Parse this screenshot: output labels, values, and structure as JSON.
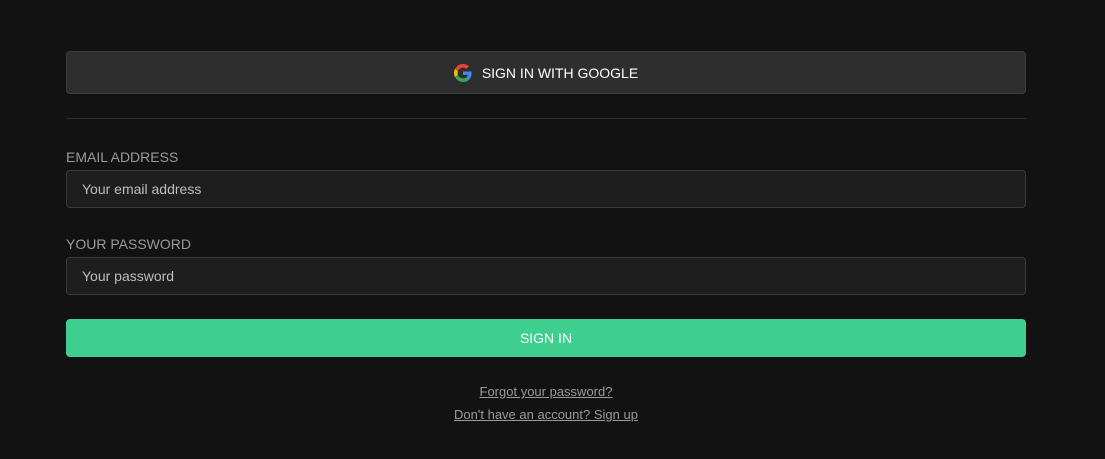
{
  "google_button": {
    "label": "SIGN IN WITH GOOGLE",
    "icon": "google-g-icon"
  },
  "email": {
    "label": "EMAIL ADDRESS",
    "placeholder": "Your email address",
    "value": ""
  },
  "password": {
    "label": "YOUR PASSWORD",
    "placeholder": "Your password",
    "value": ""
  },
  "signin_button": {
    "label": "SIGN IN"
  },
  "links": {
    "forgot": "Forgot your password?",
    "signup": "Don't have an account? Sign up"
  },
  "colors": {
    "background": "#121212",
    "accent": "#3ecf8e",
    "input_bg": "#1e1e1e",
    "button_bg": "#2e2e2e"
  }
}
